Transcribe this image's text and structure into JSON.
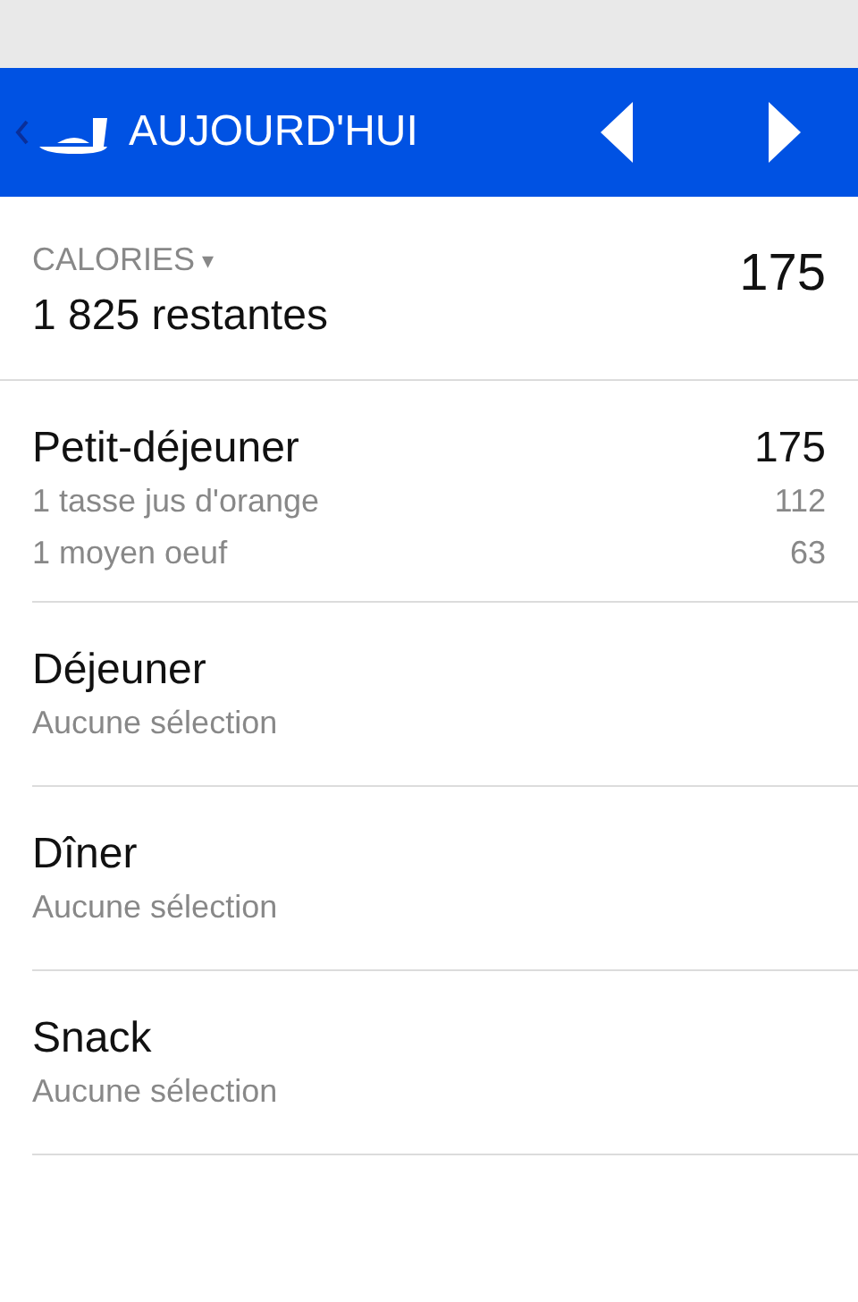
{
  "header": {
    "title": "AUJOURD'HUI"
  },
  "calories": {
    "label": "CALORIES",
    "caret": "▾",
    "remaining": "1 825 restantes",
    "total": "175"
  },
  "meals": [
    {
      "name": "Petit-déjeuner",
      "total": "175",
      "items": [
        {
          "name": "1 tasse jus d'orange",
          "calories": "112"
        },
        {
          "name": "1 moyen oeuf",
          "calories": "63"
        }
      ]
    },
    {
      "name": "Déjeuner",
      "empty_text": "Aucune sélection"
    },
    {
      "name": "Dîner",
      "empty_text": "Aucune sélection"
    },
    {
      "name": "Snack",
      "empty_text": "Aucune sélection"
    }
  ]
}
